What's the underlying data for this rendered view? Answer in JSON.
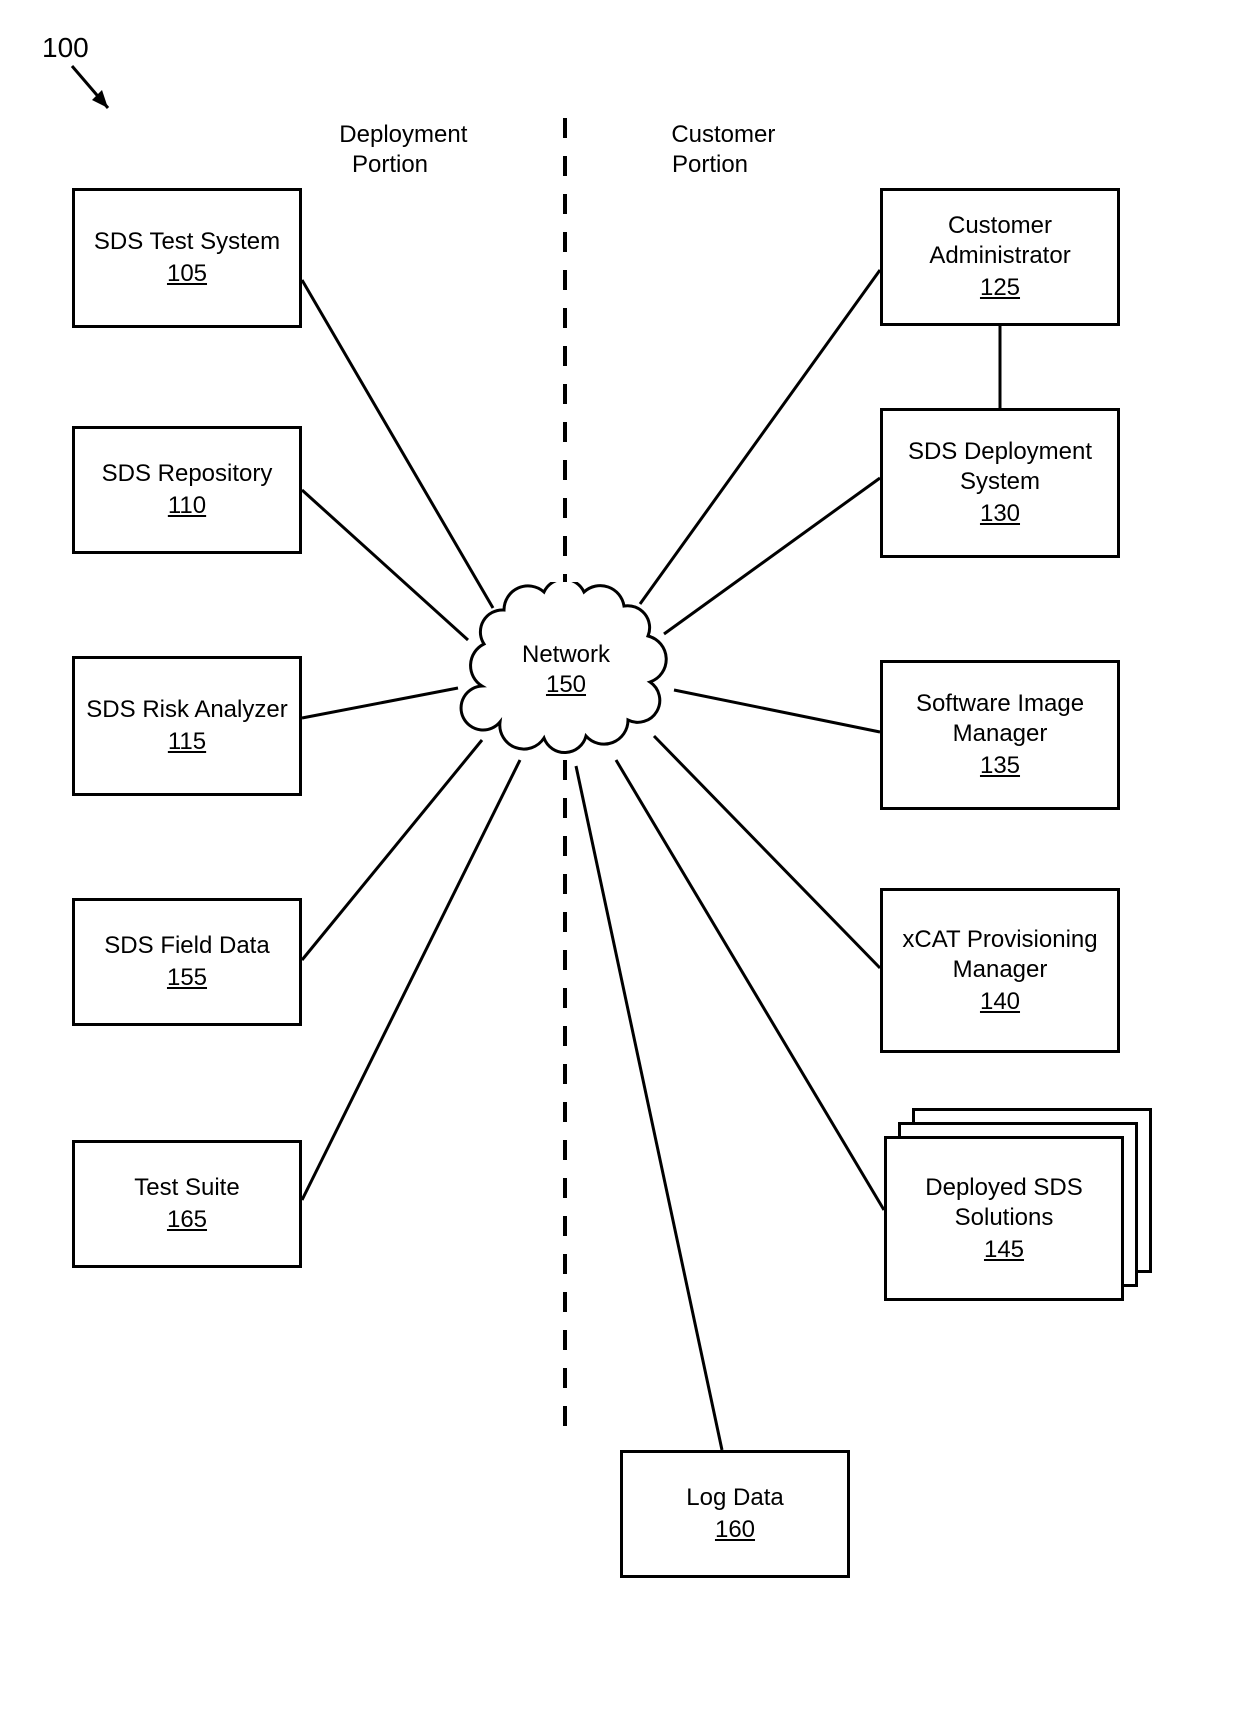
{
  "figure_ref": "100",
  "headers": {
    "left": "Deployment\nPortion",
    "right": "Customer\nPortion"
  },
  "network": {
    "label": "Network",
    "ref": "150"
  },
  "left_nodes": [
    {
      "label": "SDS Test System",
      "ref": "105"
    },
    {
      "label": "SDS Repository",
      "ref": "110"
    },
    {
      "label": "SDS Risk Analyzer",
      "ref": "115"
    },
    {
      "label": "SDS Field Data",
      "ref": "155"
    },
    {
      "label": "Test Suite",
      "ref": "165"
    }
  ],
  "right_nodes": [
    {
      "label": "Customer Administrator",
      "ref": "125"
    },
    {
      "label": "SDS Deployment System",
      "ref": "130"
    },
    {
      "label": "Software Image Manager",
      "ref": "135"
    },
    {
      "label": "xCAT Provisioning Manager",
      "ref": "140"
    },
    {
      "label": "Deployed SDS Solutions",
      "ref": "145",
      "stacked": true
    }
  ],
  "bottom_node": {
    "label": "Log Data",
    "ref": "160"
  }
}
